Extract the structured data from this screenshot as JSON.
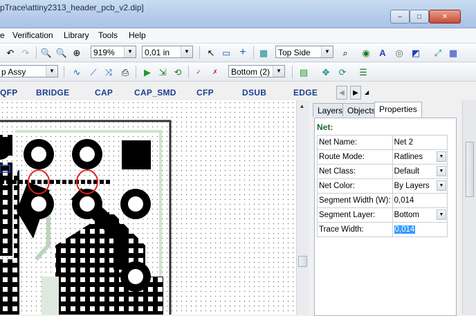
{
  "window": {
    "title": "pTrace\\attiny2313_header_pcb_v2.dip]",
    "minimize": "–",
    "maximize": "□",
    "close": "✕"
  },
  "menu": [
    "e",
    "Verification",
    "Library",
    "Tools",
    "Help"
  ],
  "toolbar1": {
    "zoom": "919%",
    "grid": "0,01 in",
    "side": "Top Side"
  },
  "toolbar2": {
    "assy": "p Assy",
    "layer": "Bottom (2)"
  },
  "library": {
    "items": [
      "QFP",
      "BRIDGE",
      "CAP",
      "CAP_SMD",
      "CFP",
      "DSUB",
      "EDGE"
    ]
  },
  "panel": {
    "tabs": [
      "Layers",
      "Objects",
      "Properties"
    ],
    "header": "Net:",
    "properties": [
      {
        "name": "Net Name:",
        "value": "Net 2",
        "dropdown": false
      },
      {
        "name": "Route Mode:",
        "value": "Ratlines",
        "dropdown": true
      },
      {
        "name": "Net Class:",
        "value": "Default",
        "dropdown": true
      },
      {
        "name": "Net Color:",
        "value": "By Layers",
        "dropdown": true
      },
      {
        "name": "Segment Width (W):",
        "value": "0,014",
        "dropdown": false
      },
      {
        "name": "Segment Layer:",
        "value": "Bottom",
        "dropdown": true
      },
      {
        "name": "Trace Width:",
        "value": "0,014",
        "dropdown": false
      }
    ]
  },
  "colors": {
    "accent": "#1b3f8f",
    "net_header": "#1a6b2f",
    "highlight": "#e02020",
    "selection": "#3399ff"
  }
}
